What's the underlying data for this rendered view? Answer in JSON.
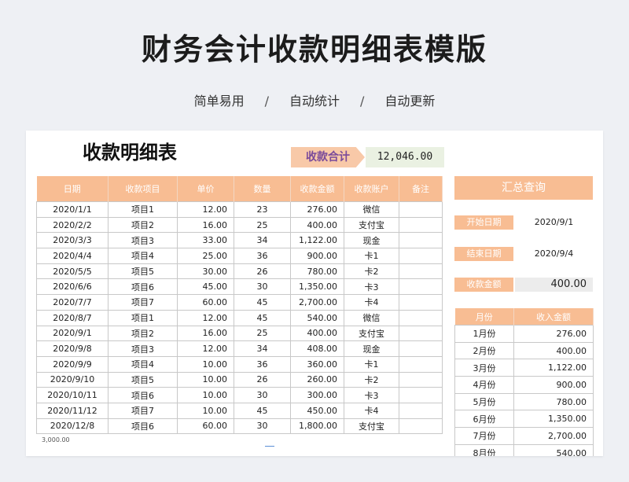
{
  "banner": {
    "title": "财务会计收款明细表模版",
    "features": [
      "简单易用",
      "自动统计",
      "自动更新"
    ],
    "separator": "/"
  },
  "sheet": {
    "title": "收款明细表",
    "total_label": "收款合计",
    "total_value": "12,046.00",
    "columns": [
      "日期",
      "收款项目",
      "单价",
      "数量",
      "收款金额",
      "收款账户",
      "备注"
    ],
    "rows": [
      [
        "2020/1/1",
        "项目1",
        "12.00",
        "23",
        "276.00",
        "微信",
        ""
      ],
      [
        "2020/2/2",
        "项目2",
        "16.00",
        "25",
        "400.00",
        "支付宝",
        ""
      ],
      [
        "2020/3/3",
        "项目3",
        "33.00",
        "34",
        "1,122.00",
        "现金",
        ""
      ],
      [
        "2020/4/4",
        "项目4",
        "25.00",
        "36",
        "900.00",
        "卡1",
        ""
      ],
      [
        "2020/5/5",
        "项目5",
        "30.00",
        "26",
        "780.00",
        "卡2",
        ""
      ],
      [
        "2020/6/6",
        "项目6",
        "45.00",
        "30",
        "1,350.00",
        "卡3",
        ""
      ],
      [
        "2020/7/7",
        "项目7",
        "60.00",
        "45",
        "2,700.00",
        "卡4",
        ""
      ],
      [
        "2020/8/7",
        "项目1",
        "12.00",
        "45",
        "540.00",
        "微信",
        ""
      ],
      [
        "2020/9/1",
        "项目2",
        "16.00",
        "25",
        "400.00",
        "支付宝",
        ""
      ],
      [
        "2020/9/8",
        "项目3",
        "12.00",
        "34",
        "408.00",
        "现金",
        ""
      ],
      [
        "2020/9/9",
        "项目4",
        "10.00",
        "36",
        "360.00",
        "卡1",
        ""
      ],
      [
        "2020/9/10",
        "项目5",
        "10.00",
        "26",
        "260.00",
        "卡2",
        ""
      ],
      [
        "2020/10/11",
        "项目6",
        "10.00",
        "30",
        "300.00",
        "卡3",
        ""
      ],
      [
        "2020/11/12",
        "项目7",
        "10.00",
        "45",
        "450.00",
        "卡4",
        ""
      ],
      [
        "2020/12/8",
        "项目6",
        "60.00",
        "30",
        "1,800.00",
        "支付宝",
        ""
      ]
    ],
    "footer_note": "3,000.00"
  },
  "query": {
    "header": "汇总查询",
    "start_label": "开始日期",
    "start_value": "2020/9/1",
    "end_label": "结束日期",
    "end_value": "2020/9/4",
    "amount_label": "收款金额",
    "amount_value": "400.00",
    "month_columns": [
      "月份",
      "收入金额"
    ],
    "months": [
      [
        "1月份",
        "276.00"
      ],
      [
        "2月份",
        "400.00"
      ],
      [
        "3月份",
        "1,122.00"
      ],
      [
        "4月份",
        "900.00"
      ],
      [
        "5月份",
        "780.00"
      ],
      [
        "6月份",
        "1,350.00"
      ],
      [
        "7月份",
        "2,700.00"
      ],
      [
        "8月份",
        "540.00"
      ]
    ]
  },
  "colors": {
    "header_orange": "#f8bd93",
    "total_label_purple": "#7a4a9a",
    "total_value_bg": "#eaf1e2"
  }
}
